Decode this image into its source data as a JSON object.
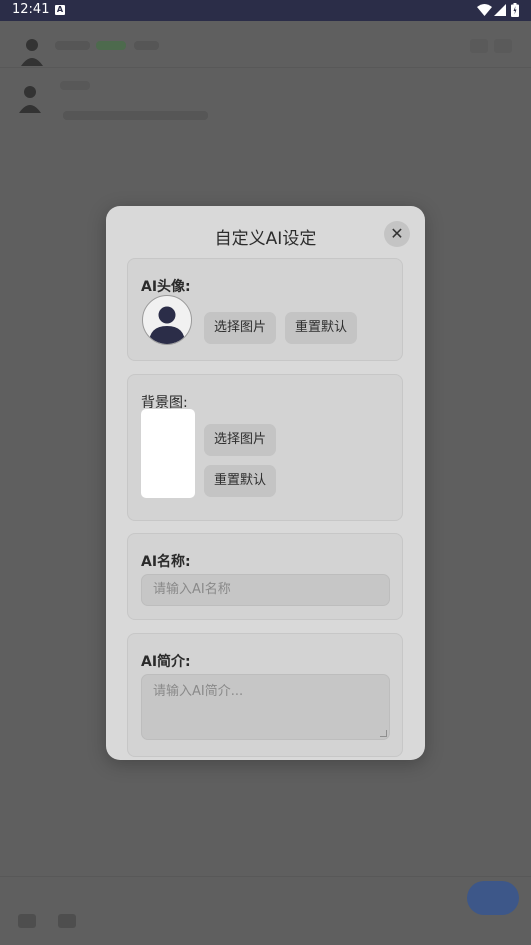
{
  "status_bar": {
    "time": "12:41",
    "notification_icon": "A",
    "icons": [
      "wifi-icon",
      "cell-signal-icon",
      "battery-icon"
    ]
  },
  "dialog": {
    "title": "自定义AI设定",
    "close_label": "✕",
    "avatar_section": {
      "label": "AI头像:",
      "choose_label": "选择图片",
      "reset_label": "重置默认",
      "avatar_icon": "person-avatar-icon"
    },
    "background_section": {
      "label": "背景图:",
      "choose_label": "选择图片",
      "reset_label": "重置默认"
    },
    "name_section": {
      "label": "AI名称:",
      "value": "",
      "placeholder": "请输入AI名称"
    },
    "intro_section": {
      "label": "AI简介:",
      "value": "",
      "placeholder": "请输入AI简介..."
    }
  },
  "colors": {
    "status_bar_bg": "#2b2d48",
    "scrim_bg": "#5f5f5f",
    "dialog_bg": "#d9d9d9",
    "button_bg": "#c4c4c4",
    "avatar_fg": "#2b2d48",
    "fab": "#3d5789"
  }
}
